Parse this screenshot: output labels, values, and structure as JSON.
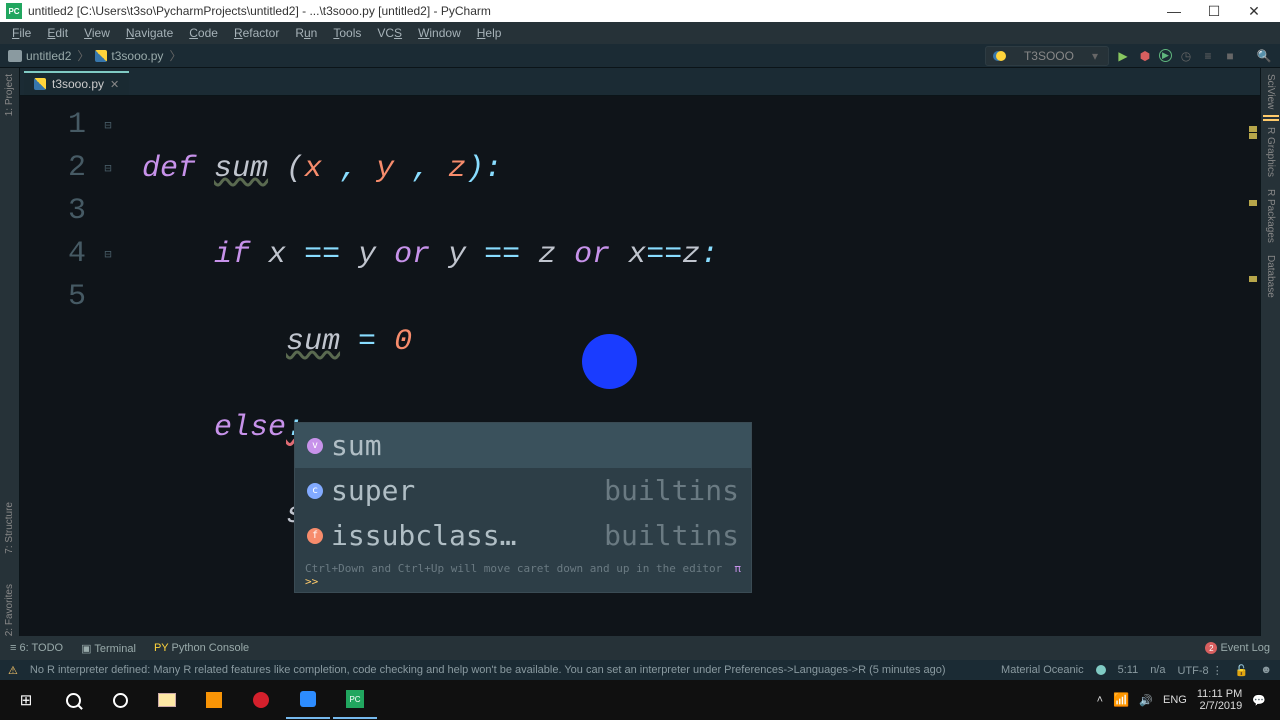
{
  "window": {
    "title": "untitled2 [C:\\Users\\t3so\\PycharmProjects\\untitled2] - ...\\t3sooo.py [untitled2] - PyCharm"
  },
  "menu": {
    "file": "File",
    "edit": "Edit",
    "view": "View",
    "navigate": "Navigate",
    "code": "Code",
    "refactor": "Refactor",
    "run": "Run",
    "tools": "Tools",
    "vcs": "VCS",
    "window": "Window",
    "help": "Help"
  },
  "breadcrumb": {
    "project": "untitled2",
    "file": "t3sooo.py"
  },
  "run_config": {
    "name": "T3SOOO"
  },
  "tab": {
    "name": "t3sooo.py"
  },
  "lines": {
    "l1": "1",
    "l2": "2",
    "l3": "3",
    "l4": "4",
    "l5": "5"
  },
  "code": {
    "def": "def",
    "sum": "sum",
    "params_open": " (",
    "x": "x",
    "comma": " , ",
    "y": "y",
    "z": "z",
    "params_close": "):",
    "if": "if",
    "eq": " == ",
    "or": " or ",
    "eq2": "==",
    "colon": ":",
    "assign": " = ",
    "zero": "0",
    "else": "else",
    "su": "su"
  },
  "autocomplete": {
    "items": [
      {
        "kind": "v",
        "name": "sum",
        "mod": ""
      },
      {
        "kind": "c",
        "name": "super",
        "mod": "builtins"
      },
      {
        "kind": "f",
        "name": "issubclass…",
        "mod": "builtins"
      }
    ],
    "hint": "Ctrl+Down and Ctrl+Up will move caret down and up in the editor",
    "hint_link": ">>"
  },
  "left_tabs": {
    "project": "1: Project",
    "structure": "7: Structure",
    "favorites": "2: Favorites"
  },
  "right_tabs": {
    "sciview": "SciView",
    "rgraphics": "R Graphics",
    "rpackages": "R Packages",
    "database": "Database"
  },
  "bottom_tools": {
    "todo": "6: TODO",
    "terminal": "Terminal",
    "python_console": "Python Console",
    "event_log": "Event Log"
  },
  "status": {
    "msg": "No R interpreter defined: Many R related features like completion, code checking and help won't be available. You can set an interpreter under Preferences->Languages->R (5 minutes ago)",
    "theme": "Material Oceanic",
    "pos": "5:11",
    "na": "n/a",
    "enc": "UTF-8",
    "lock": "🔒"
  },
  "taskbar": {
    "lang": "ENG",
    "time": "11:11 PM",
    "date": "2/7/2019"
  }
}
